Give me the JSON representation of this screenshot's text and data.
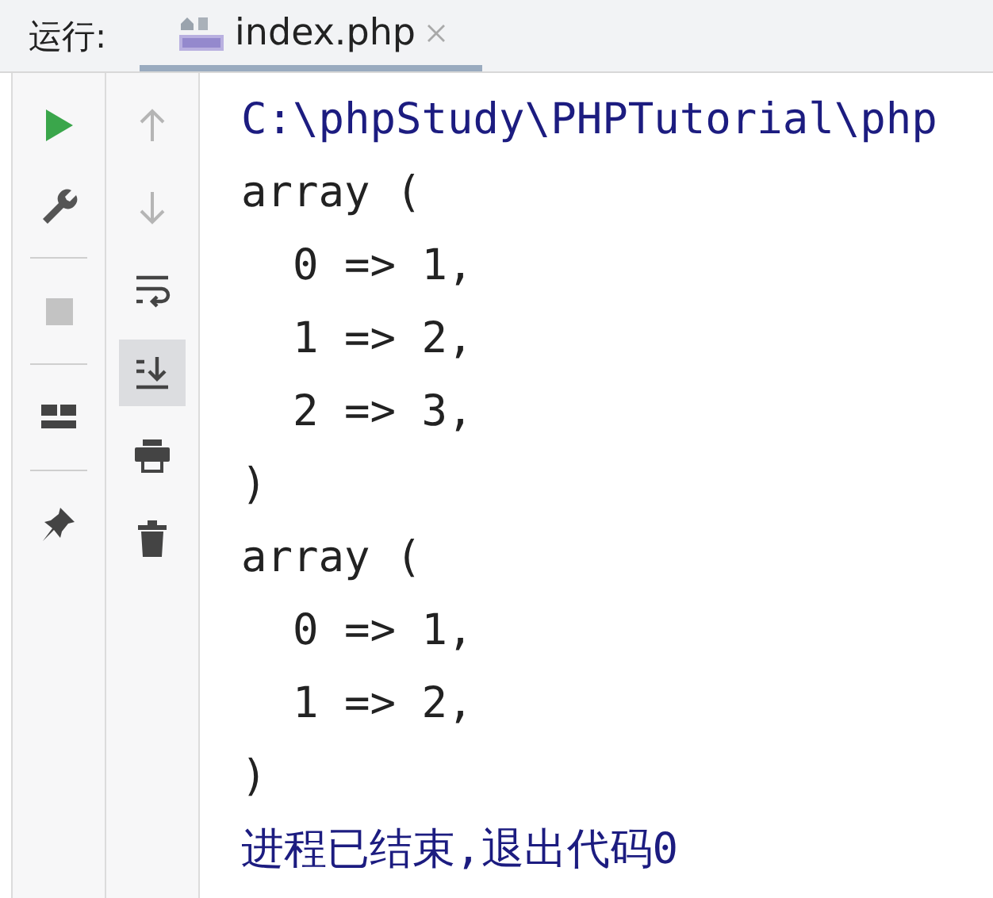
{
  "header": {
    "label": "运行:",
    "tab": {
      "title": "index.php",
      "selected": true
    }
  },
  "left_toolbar": [
    {
      "kind": "run",
      "disabled": false
    },
    {
      "kind": "wrench",
      "disabled": false
    },
    {
      "kind": "separator"
    },
    {
      "kind": "stop",
      "disabled": true
    },
    {
      "kind": "separator"
    },
    {
      "kind": "layout",
      "disabled": false
    },
    {
      "kind": "separator"
    },
    {
      "kind": "pin",
      "disabled": false
    }
  ],
  "right_toolbar": [
    {
      "kind": "up",
      "disabled": true,
      "selected": false
    },
    {
      "kind": "down",
      "disabled": true,
      "selected": false
    },
    {
      "kind": "wrap",
      "disabled": false,
      "selected": false
    },
    {
      "kind": "scroll-end",
      "disabled": false,
      "selected": true
    },
    {
      "kind": "print",
      "disabled": false,
      "selected": false
    },
    {
      "kind": "trash",
      "disabled": false,
      "selected": false
    }
  ],
  "console": [
    {
      "kind": "system",
      "text": "C:\\phpStudy\\PHPTutorial\\php"
    },
    {
      "kind": "output",
      "text": "array ("
    },
    {
      "kind": "output",
      "text": "  0 => 1,"
    },
    {
      "kind": "output",
      "text": "  1 => 2,"
    },
    {
      "kind": "output",
      "text": "  2 => 3,"
    },
    {
      "kind": "output",
      "text": ")"
    },
    {
      "kind": "output",
      "text": "array ("
    },
    {
      "kind": "output",
      "text": "  0 => 1,"
    },
    {
      "kind": "output",
      "text": "  1 => 2,"
    },
    {
      "kind": "output",
      "text": ")"
    },
    {
      "kind": "system",
      "text": "进程已结束,退出代码0"
    }
  ]
}
